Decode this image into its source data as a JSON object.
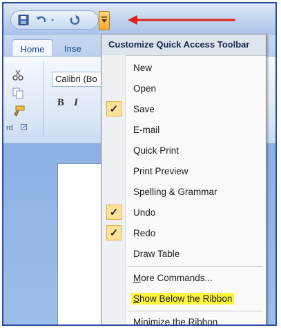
{
  "quick_access": {
    "buttons": [
      {
        "name": "save-icon"
      },
      {
        "name": "undo-icon"
      },
      {
        "name": "redo-icon"
      }
    ],
    "customize_button": {
      "name": "customize-qat-dropdown-icon"
    },
    "annotation_color": "#e0201a"
  },
  "ribbon": {
    "tabs": [
      {
        "label": "Home",
        "active": true
      },
      {
        "label": "Inse",
        "active": false
      }
    ],
    "font_name": "Calibri (Bo",
    "bold_label": "B",
    "italic_label": "I",
    "group_label": "rd"
  },
  "menu": {
    "title": "Customize Quick Access Toolbar",
    "items": [
      {
        "label": "New",
        "checked": false
      },
      {
        "label": "Open",
        "checked": false
      },
      {
        "label": "Save",
        "checked": true
      },
      {
        "label": "E-mail",
        "checked": false
      },
      {
        "label": "Quick Print",
        "checked": false
      },
      {
        "label": "Print Preview",
        "checked": false
      },
      {
        "label": "Spelling & Grammar",
        "checked": false
      },
      {
        "label": "Undo",
        "checked": true
      },
      {
        "label": "Redo",
        "checked": true
      },
      {
        "label": "Draw Table",
        "checked": false
      }
    ],
    "more_commands": {
      "underline_char": "M",
      "rest": "ore Commands..."
    },
    "show_below": {
      "underline_char": "S",
      "rest": "how Below the Ribbon",
      "highlight_color": "#fff53a"
    },
    "minimize": {
      "before": "Mi",
      "underline_char": "n",
      "rest": "imize the Ribbon"
    },
    "check_mark": "✓"
  }
}
